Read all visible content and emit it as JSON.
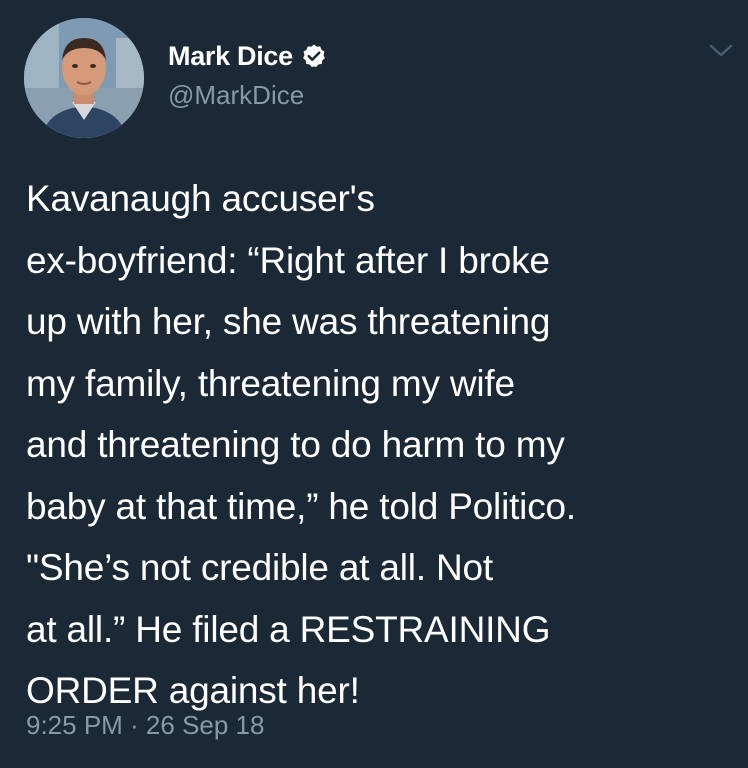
{
  "tweet": {
    "author": {
      "display_name": "Mark Dice",
      "handle": "@MarkDice",
      "verified": true,
      "avatar_icon": "profile-photo"
    },
    "menu_icon": "chevron-down-icon",
    "text": "Kavanaugh accuser's\nex-boyfriend: “Right after I broke\nup with her, she was threatening\nmy family, threatening my wife\nand threatening to do harm to my\nbaby at that time,” he told Politico.\n\"She’s not credible at all.  Not\nat all.”  He filed a RESTRAINING\nORDER against her!",
    "timestamp": "9:25 PM · 26 Sep 18"
  },
  "colors": {
    "background": "#1b2836",
    "text": "#ffffff",
    "secondary_text": "#8899a6",
    "verified_badge": "#ffffff"
  }
}
